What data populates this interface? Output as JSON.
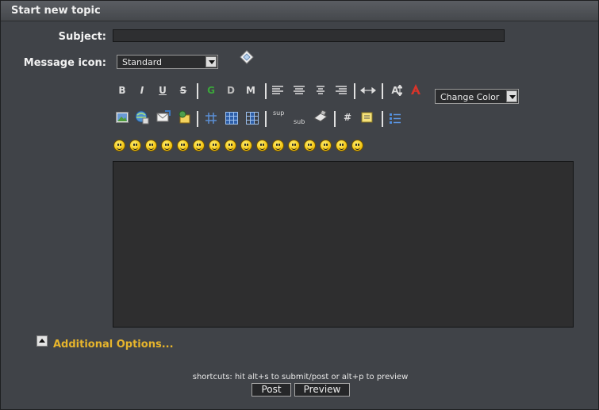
{
  "title": "Start new topic",
  "form": {
    "subject_label": "Subject:",
    "subject_value": "",
    "message_icon_label": "Message icon:",
    "message_icon_value": "Standard"
  },
  "toolbar": {
    "row1": [
      "B",
      "I",
      "U",
      "S",
      "G",
      "D",
      "M",
      "A"
    ],
    "sup": "sup",
    "sub": "sub",
    "hash": "#",
    "change_color": "Change Color"
  },
  "smileys": [
    "smiley",
    "smiley",
    "smiley",
    "smiley",
    "smiley",
    "smiley",
    "smiley",
    "smiley",
    "smiley",
    "smiley",
    "smiley",
    "smiley",
    "smiley",
    "smiley",
    "smiley",
    "smiley"
  ],
  "additional_options": "Additional Options...",
  "shortcuts": "shortcuts: hit alt+s to submit/post or alt+p to preview",
  "buttons": {
    "post": "Post",
    "preview": "Preview"
  },
  "colors": {
    "accent": "#e7b52c",
    "background": "#404348",
    "field": "#2e2e2f"
  }
}
